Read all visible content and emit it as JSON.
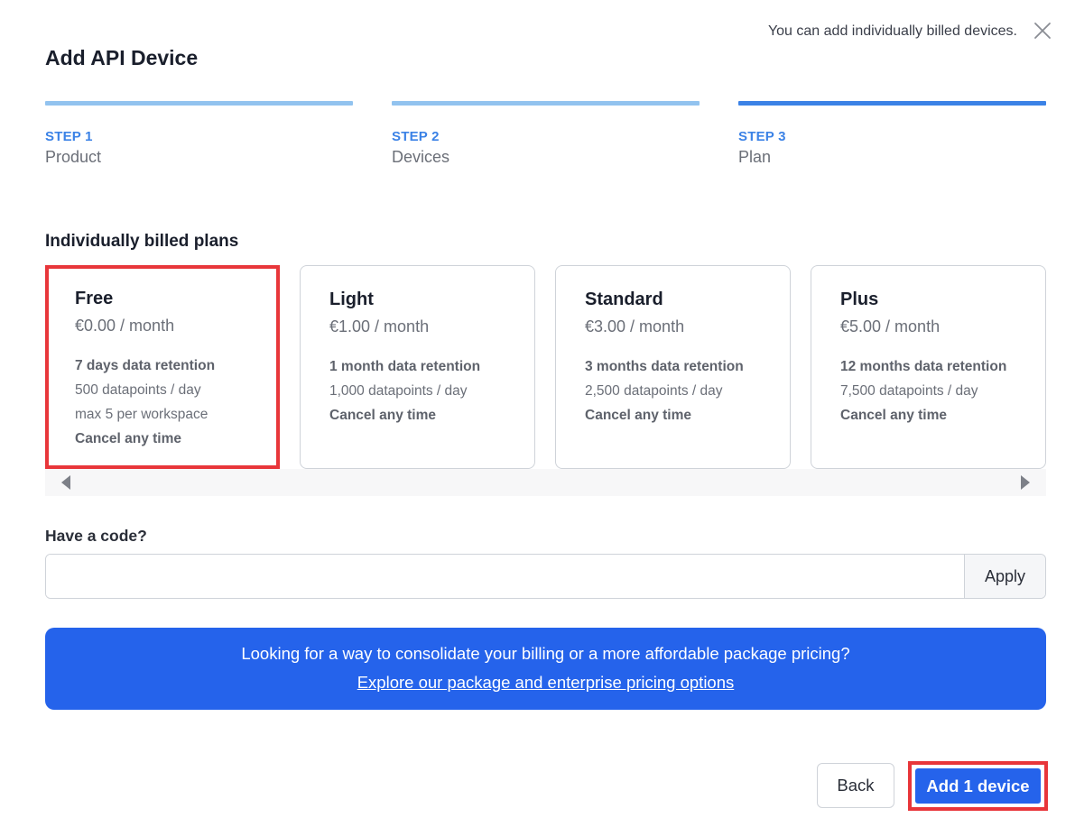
{
  "header": {
    "title": "Add API Device",
    "subtitle": "You can add individually billed devices.",
    "close_icon": "close-icon"
  },
  "steps": [
    {
      "num": "STEP 1",
      "name": "Product"
    },
    {
      "num": "STEP 2",
      "name": "Devices"
    },
    {
      "num": "STEP 3",
      "name": "Plan"
    }
  ],
  "active_step": 3,
  "plans_section": {
    "title": "Individually billed plans",
    "plans": [
      {
        "name": "Free",
        "price": "€0.00 / month",
        "features": [
          "7 days data retention",
          "500 datapoints / day",
          "max 5 per workspace",
          "Cancel any time"
        ]
      },
      {
        "name": "Light",
        "price": "€1.00 / month",
        "features": [
          "1 month data retention",
          "1,000 datapoints / day",
          "Cancel any time"
        ]
      },
      {
        "name": "Standard",
        "price": "€3.00 / month",
        "features": [
          "3 months data retention",
          "2,500 datapoints / day",
          "Cancel any time"
        ]
      },
      {
        "name": "Plus",
        "price": "€5.00 / month",
        "features": [
          "12 months data retention",
          "7,500 datapoints / day",
          "Cancel any time"
        ]
      }
    ],
    "selected": "Free"
  },
  "code": {
    "label": "Have a code?",
    "value": "",
    "placeholder": "",
    "apply_label": "Apply"
  },
  "promo": {
    "text": "Looking for a way to consolidate your billing or a more affordable package pricing?",
    "link": "Explore our package and enterprise pricing options"
  },
  "footer": {
    "back_label": "Back",
    "add_label": "Add 1 device"
  },
  "colors": {
    "primary": "#2563eb",
    "step_active": "#3b82e6",
    "step_inactive": "#92c3ef",
    "highlight": "#e8363a"
  }
}
